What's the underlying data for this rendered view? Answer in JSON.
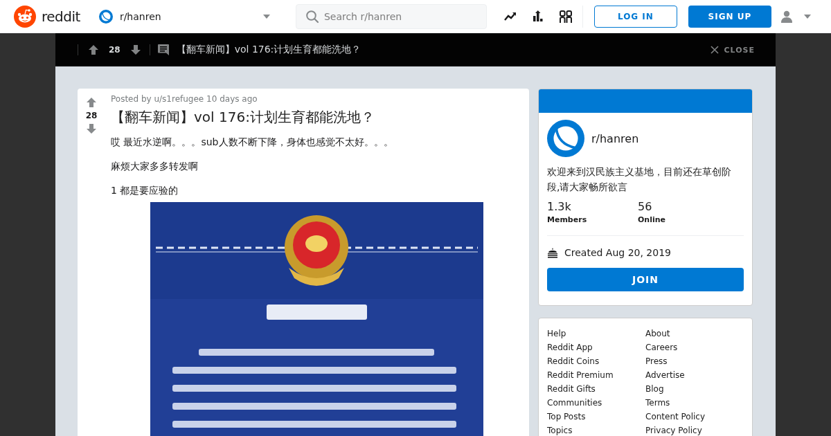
{
  "header": {
    "logo": "reddit",
    "community": "r/hanren",
    "search": {
      "placeholder": "Search r/hanren"
    },
    "login": "LOG IN",
    "signup": "SIGN UP"
  },
  "post_bar": {
    "score": "28",
    "title": "【翻车新闻】vol 176:计划生育都能洗地？",
    "close": "CLOSE"
  },
  "post": {
    "meta": "Posted by u/s1refugee 10 days ago",
    "score": "28",
    "title": "【翻车新闻】vol 176:计划生育都能洗地？",
    "paragraphs": [
      "哎 最近水逆啊。。。sub人数不断下降，身体也感觉不太好。。。",
      "麻烦大家多多转发啊",
      "1 都是要应验的"
    ]
  },
  "about": {
    "name": "r/hanren",
    "description": "欢迎来到汉民族主义基地，目前还在草创阶段,请大家畅所欲言",
    "stats": [
      {
        "value": "1.3k",
        "label": "Members"
      },
      {
        "value": "56",
        "label": "Online"
      }
    ],
    "created": "Created Aug 20, 2019",
    "join": "JOIN"
  },
  "link_columns": [
    [
      "Help",
      "Reddit App",
      "Reddit Coins",
      "Reddit Premium",
      "Reddit Gifts",
      "Communities",
      "Top Posts",
      "Topics"
    ],
    [
      "About",
      "Careers",
      "Press",
      "Advertise",
      "Blog",
      "Terms",
      "Content Policy",
      "Privacy Policy"
    ]
  ]
}
